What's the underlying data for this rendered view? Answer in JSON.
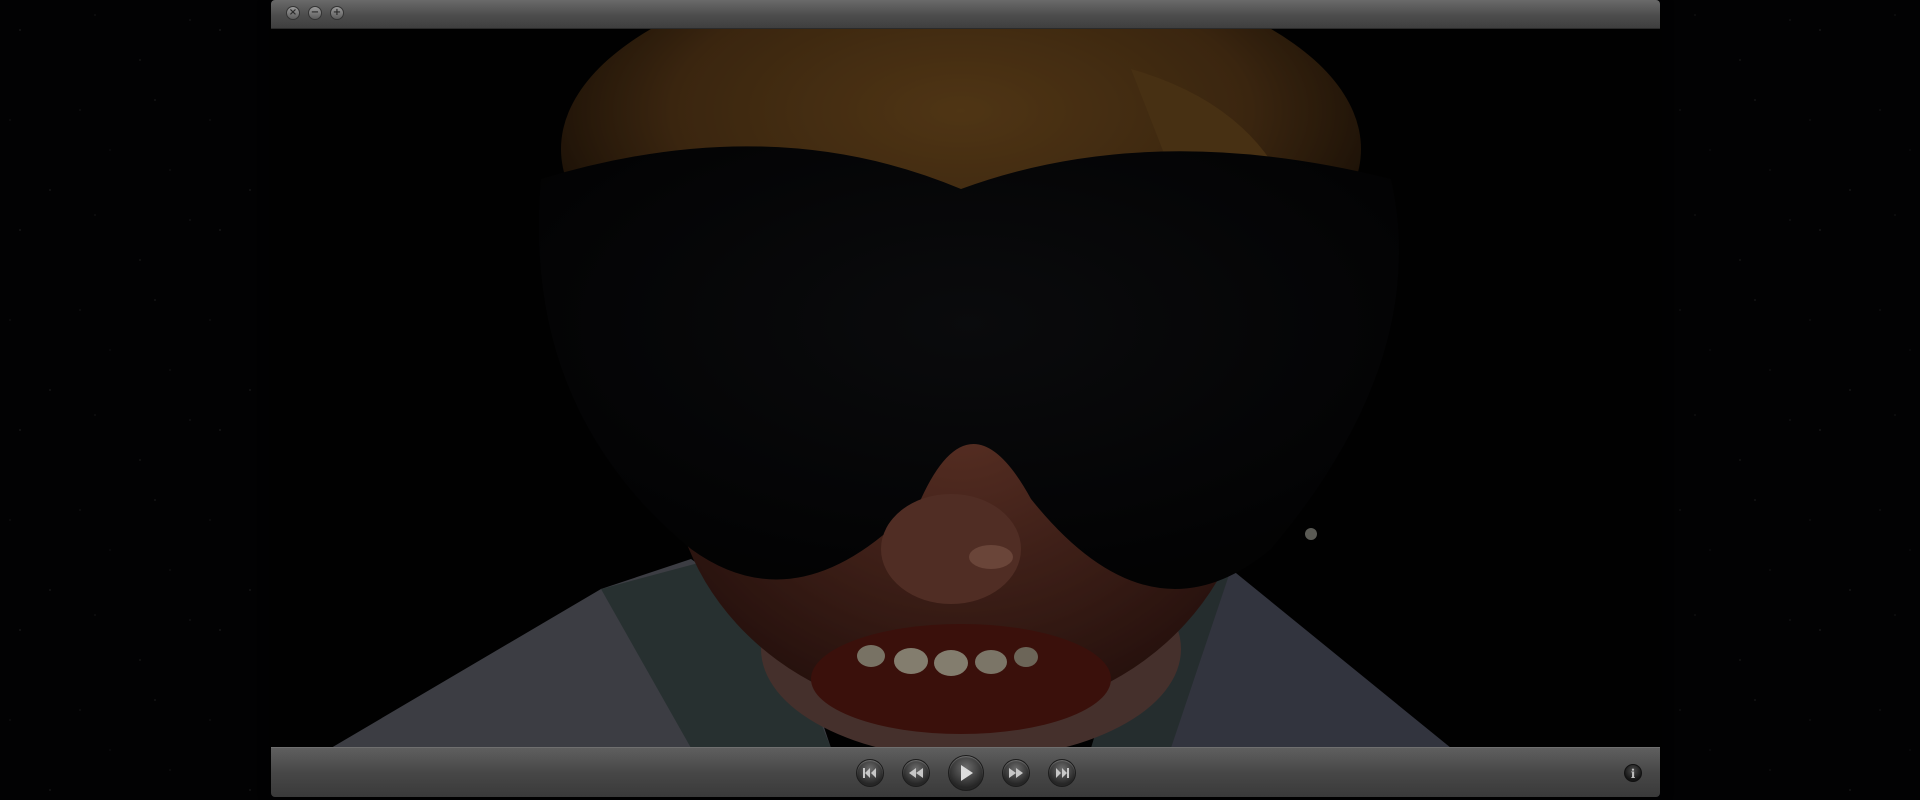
{
  "window": {
    "buttons": {
      "close_glyph": "×",
      "minimize_glyph": "−",
      "zoom_glyph": "+"
    }
  },
  "video": {
    "state": "paused"
  },
  "controls": {
    "buttons": [
      {
        "name": "skip-back",
        "icon": "skip-to-start-icon"
      },
      {
        "name": "rewind",
        "icon": "rewind-icon"
      },
      {
        "name": "play",
        "icon": "play-icon"
      },
      {
        "name": "fast-forward",
        "icon": "fast-forward-icon"
      },
      {
        "name": "skip-forward",
        "icon": "skip-to-end-icon"
      }
    ],
    "info_glyph": "i"
  },
  "colors": {
    "titlebar": "#4c4c4c",
    "controlbar": "#474747",
    "icon": "#c8c8c8"
  }
}
